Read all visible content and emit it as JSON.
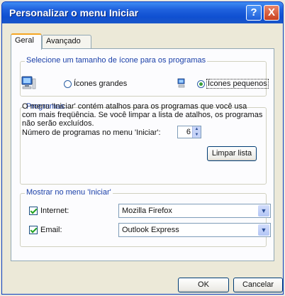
{
  "window": {
    "title": "Personalizar o menu Iniciar",
    "help_label": "?",
    "close_label": "X"
  },
  "tabs": [
    {
      "label": "Geral",
      "active": true
    },
    {
      "label": "Avançado",
      "active": false
    }
  ],
  "icon_size": {
    "legend": "Selecione um tamanho de ícone para os programas",
    "large_label": "Ícones grandes",
    "small_label": "Ícones pequenos",
    "selected": "small",
    "large_icon": "computer-icon",
    "small_icon": "computer-small-icon"
  },
  "programs": {
    "legend": "Programas",
    "description": "O menu 'Iniciar' contém atalhos para os programas que você usa com mais freqüência. Se você limpar a lista de atalhos, os programas não serão excluídos.",
    "count_label": "Número de programas no menu 'Iniciar':",
    "count_value": "6",
    "clear_button": "Limpar lista"
  },
  "show_in_menu": {
    "legend": "Mostrar no menu 'Iniciar'",
    "internet_label": "Internet:",
    "internet_checked": true,
    "internet_value": "Mozilla Firefox",
    "email_label": "Email:",
    "email_checked": true,
    "email_value": "Outlook Express"
  },
  "footer": {
    "ok": "OK",
    "cancel": "Cancelar"
  },
  "colors": {
    "titlebar": "#0f4fd1",
    "group_label": "#1a3fa8",
    "tab_highlight": "#f5a623"
  }
}
